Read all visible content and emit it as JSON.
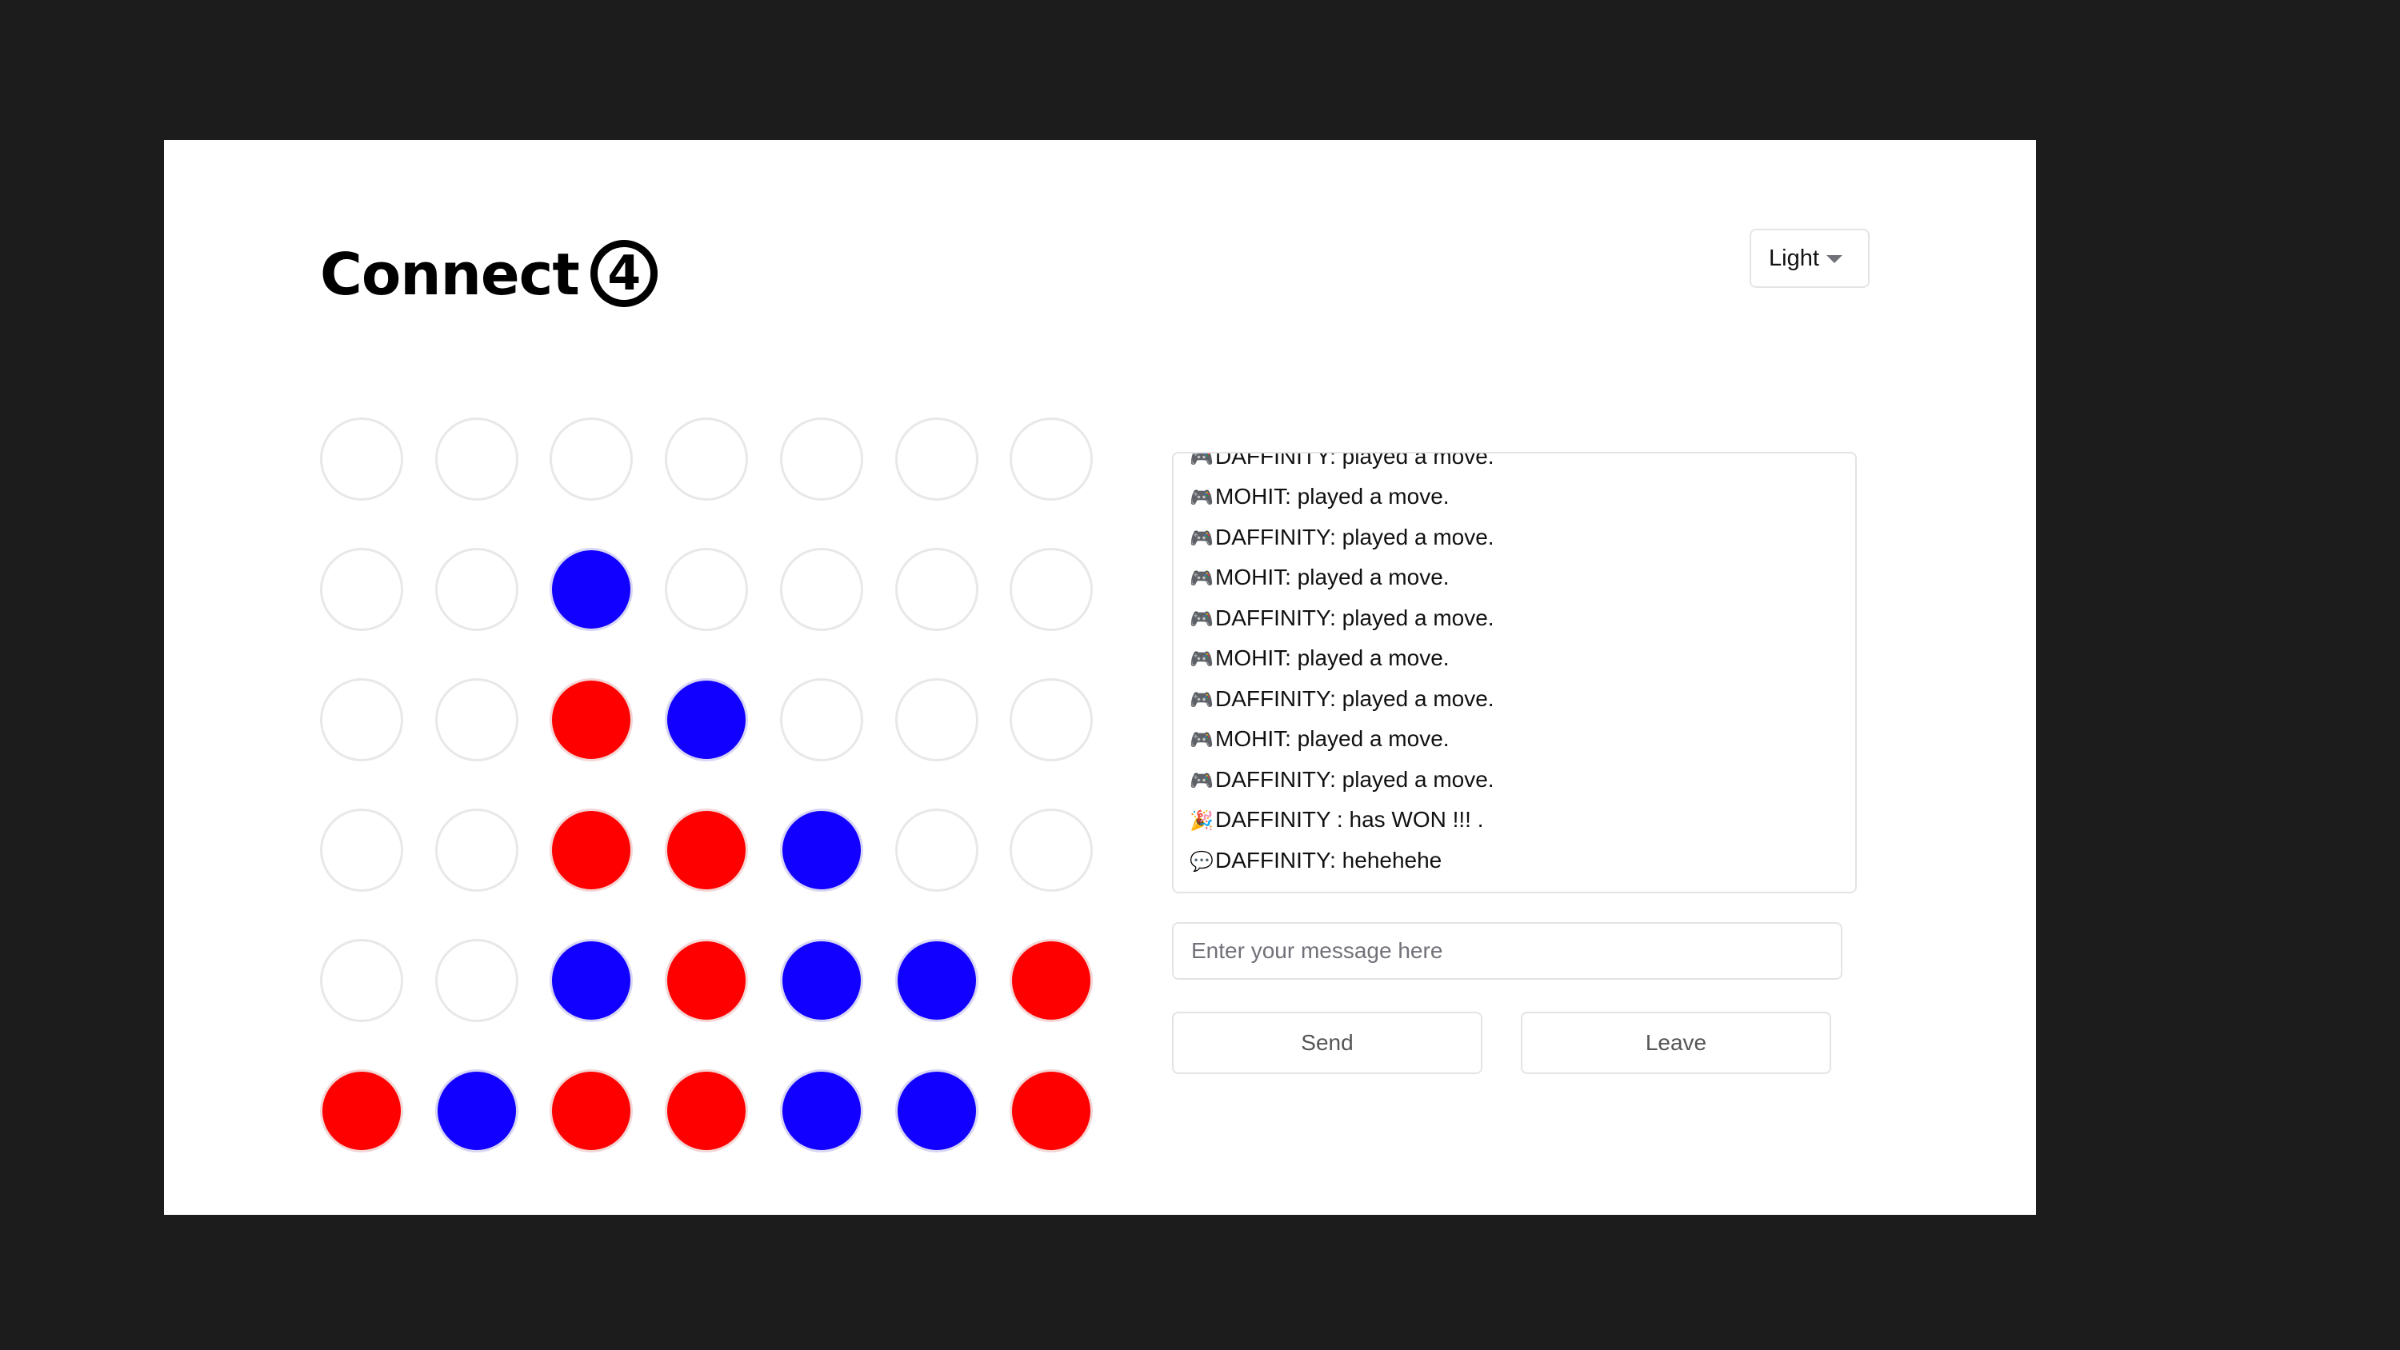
{
  "header": {
    "title": "Connect",
    "title_badge": "4"
  },
  "theme": {
    "selected": "Light"
  },
  "board": {
    "rows": 6,
    "cols": 7,
    "colors": {
      "red": "#ff0000",
      "blue": "#1100ff",
      "empty": "#ffffff"
    },
    "grid": [
      [
        "empty",
        "empty",
        "empty",
        "empty",
        "empty",
        "empty",
        "empty"
      ],
      [
        "empty",
        "empty",
        "blue",
        "empty",
        "empty",
        "empty",
        "empty"
      ],
      [
        "empty",
        "empty",
        "red",
        "blue",
        "empty",
        "empty",
        "empty"
      ],
      [
        "empty",
        "empty",
        "red",
        "red",
        "blue",
        "empty",
        "empty"
      ],
      [
        "empty",
        "empty",
        "blue",
        "red",
        "blue",
        "blue",
        "red"
      ],
      [
        "red",
        "blue",
        "red",
        "red",
        "blue",
        "blue",
        "red"
      ]
    ]
  },
  "chat": {
    "messages": [
      {
        "icon": "🎮",
        "text": "DAFFINITY: played a move."
      },
      {
        "icon": "🎮",
        "text": "MOHIT: played a move."
      },
      {
        "icon": "🎮",
        "text": "DAFFINITY: played a move."
      },
      {
        "icon": "🎮",
        "text": "MOHIT: played a move."
      },
      {
        "icon": "🎮",
        "text": "DAFFINITY: played a move."
      },
      {
        "icon": "🎮",
        "text": "MOHIT: played a move."
      },
      {
        "icon": "🎮",
        "text": "DAFFINITY: played a move."
      },
      {
        "icon": "🎮",
        "text": "MOHIT: played a move."
      },
      {
        "icon": "🎮",
        "text": "DAFFINITY: played a move."
      },
      {
        "icon": "🎉",
        "text": "DAFFINITY : has WON !!! ."
      },
      {
        "icon": "💬",
        "text": "DAFFINITY: hehehehe"
      }
    ],
    "input_value": "",
    "input_placeholder": "Enter your message here",
    "send_label": "Send",
    "leave_label": "Leave"
  }
}
